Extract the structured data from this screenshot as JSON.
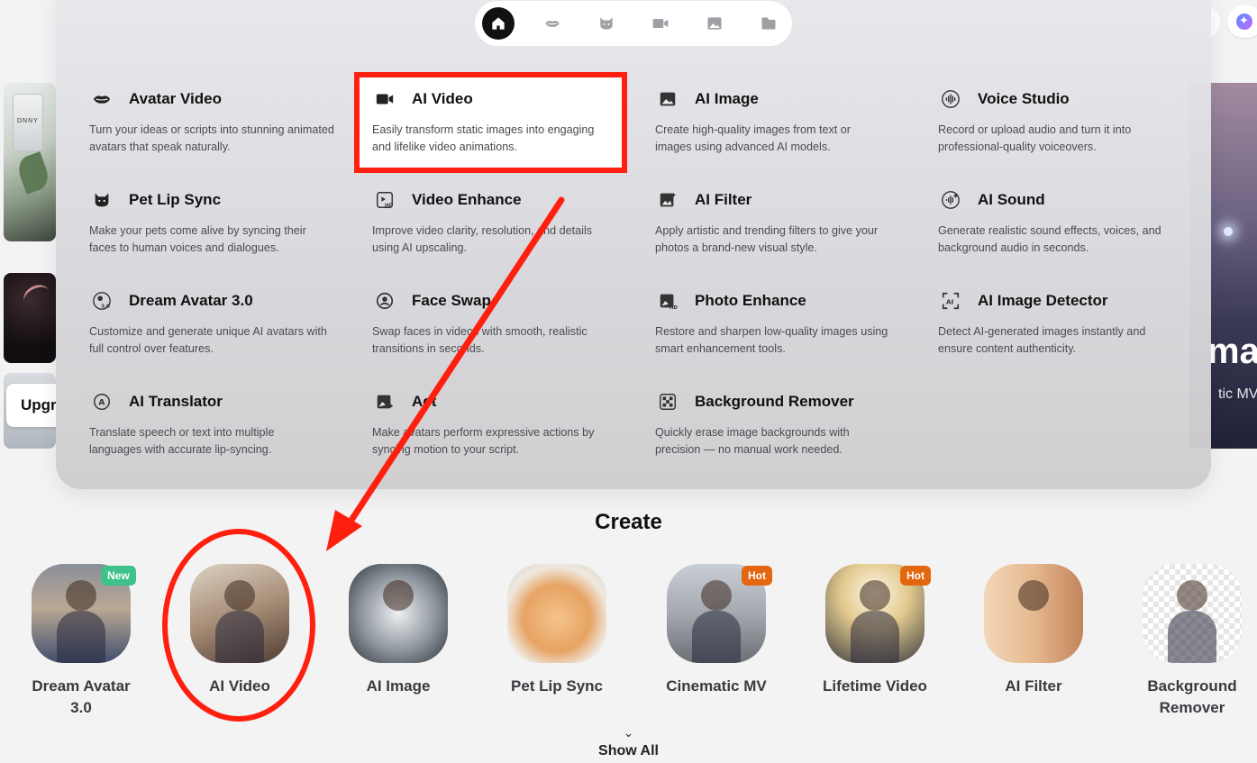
{
  "topbar": {
    "nav_icons": [
      "home-icon",
      "lips-icon",
      "cat-icon",
      "video-camera-icon",
      "image-icon",
      "folder-icon"
    ],
    "active": "home-icon"
  },
  "hero": {
    "upgrade_label": "Upgr",
    "right_title_fragment": "ma",
    "right_subtitle_fragment": "tic MV",
    "bottle_label": "DNNY"
  },
  "features": [
    {
      "title": "Avatar Video",
      "desc": "Turn your ideas or scripts into stunning animated avatars that speak naturally.",
      "icon": "lips-icon"
    },
    {
      "title": "AI Video",
      "desc": "Easily transform static images into engaging and lifelike video animations.",
      "icon": "video-camera-icon"
    },
    {
      "title": "AI Image",
      "desc": "Create high-quality images from text or images using advanced AI models.",
      "icon": "image-icon"
    },
    {
      "title": "Voice Studio",
      "desc": "Record or upload audio and turn it into professional-quality voiceovers.",
      "icon": "waveform-icon"
    },
    {
      "title": "Pet Lip Sync",
      "desc": "Make your pets come alive by syncing their faces to human voices and dialogues.",
      "icon": "cat-icon"
    },
    {
      "title": "Video Enhance",
      "desc": "Improve video clarity, resolution, and details using AI upscaling.",
      "icon": "video-hd-icon"
    },
    {
      "title": "AI Filter",
      "desc": "Apply artistic and trending filters to give your photos a brand-new visual style.",
      "icon": "filter-icon"
    },
    {
      "title": "AI Sound",
      "desc": "Generate realistic sound effects, voices, and background audio in seconds.",
      "icon": "sound-icon"
    },
    {
      "title": "Dream Avatar 3.0",
      "desc": "Customize and generate unique AI avatars with full control over features.",
      "icon": "dream-avatar-icon"
    },
    {
      "title": "Face Swap",
      "desc": "Swap faces in videos with smooth, realistic transitions in seconds.",
      "icon": "face-swap-icon"
    },
    {
      "title": "Photo Enhance",
      "desc": "Restore and sharpen low-quality images using smart enhancement tools.",
      "icon": "photo-hd-icon"
    },
    {
      "title": "AI Image Detector",
      "desc": "Detect AI-generated images instantly and ensure content authenticity.",
      "icon": "ai-detector-icon"
    },
    {
      "title": "AI Translator",
      "desc": "Translate speech or text into multiple languages with accurate lip-syncing.",
      "icon": "translate-icon"
    },
    {
      "title": "Act",
      "desc": "Make avatars perform expressive actions by syncing motion to your script.",
      "icon": "act-icon"
    },
    {
      "title": "Background Remover",
      "desc": "Quickly erase image backgrounds with precision — no manual work needed.",
      "icon": "background-remover-icon"
    }
  ],
  "create": {
    "title": "Create",
    "cards": [
      {
        "label": "Dream Avatar 3.0",
        "badge": "New"
      },
      {
        "label": "AI Video",
        "badge": ""
      },
      {
        "label": "AI Image",
        "badge": ""
      },
      {
        "label": "Pet Lip Sync",
        "badge": ""
      },
      {
        "label": "Cinematic MV",
        "badge": "Hot"
      },
      {
        "label": "Lifetime Video",
        "badge": "Hot"
      },
      {
        "label": "AI Filter",
        "badge": ""
      },
      {
        "label": "Background Remover",
        "badge": ""
      }
    ],
    "show_all": "Show All"
  },
  "colors": {
    "annotation_red": "#ff1f0e",
    "badge_new": "#3cc28a",
    "badge_hot": "#e2670e"
  }
}
